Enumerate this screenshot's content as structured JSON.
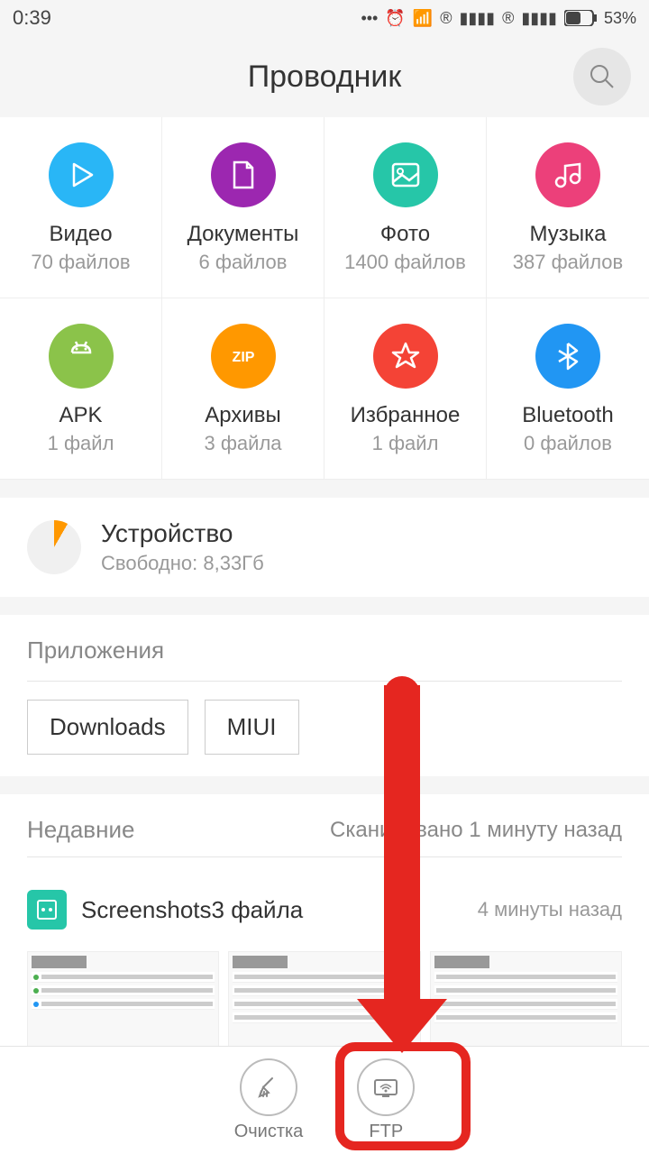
{
  "status": {
    "time": "0:39",
    "battery": "53%"
  },
  "header": {
    "title": "Проводник"
  },
  "categories": [
    {
      "label": "Видео",
      "count": "70 файлов",
      "color": "#29b6f6",
      "icon": "play"
    },
    {
      "label": "Документы",
      "count": "6 файлов",
      "color": "#9c27b0",
      "icon": "doc"
    },
    {
      "label": "Фото",
      "count": "1400 файлов",
      "color": "#26c6a8",
      "icon": "image"
    },
    {
      "label": "Музыка",
      "count": "387 файлов",
      "color": "#ec407a",
      "icon": "music"
    },
    {
      "label": "APK",
      "count": "1 файл",
      "color": "#8bc34a",
      "icon": "android"
    },
    {
      "label": "Архивы",
      "count": "3 файла",
      "color": "#ff9800",
      "icon": "zip"
    },
    {
      "label": "Избранное",
      "count": "1 файл",
      "color": "#f44336",
      "icon": "star"
    },
    {
      "label": "Bluetooth",
      "count": "0 файлов",
      "color": "#2196f3",
      "icon": "bt"
    }
  ],
  "storage": {
    "title": "Устройство",
    "free": "Свободно: 8,33Гб"
  },
  "apps": {
    "title": "Приложения",
    "chips": [
      "Downloads",
      "MIUI"
    ]
  },
  "recent": {
    "title": "Недавние",
    "scan": "Сканировано 1 минуту назад",
    "item_name": "Screenshots3 файла",
    "item_time": "4 минуты назад"
  },
  "bottom": {
    "clean": "Очистка",
    "ftp": "FTP"
  }
}
